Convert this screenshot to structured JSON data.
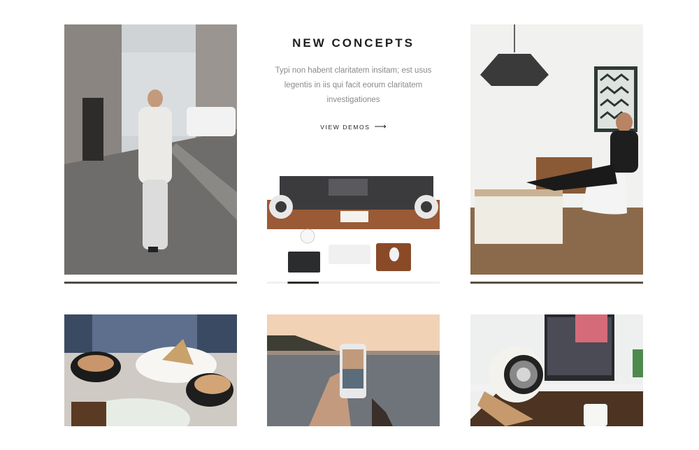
{
  "concept": {
    "title": "NEW CONCEPTS",
    "description": "Typi non habent claritatem insitam; est usus legentis in iis qui facit eorum claritatem investigationes",
    "link_label": "VIEW DEMOS",
    "link_arrow": "⟶"
  },
  "gallery": [
    {
      "subject": "man in white sweater walking on city street"
    },
    {
      "subject": "overhead view of desk with monitor, keyboard, mouse and speakers"
    },
    {
      "subject": "man sitting in chair with feet on desk under pendant lamp"
    },
    {
      "subject": "coffee cups and dessert plate on table"
    },
    {
      "subject": "hand holding smartphone photographing sunset over water"
    },
    {
      "subject": "white speaker and small figurines on desk"
    }
  ],
  "colors": {
    "progress_bar": "#5a4f44",
    "title": "#1f1f1f",
    "body_text": "#8a8a8a"
  }
}
